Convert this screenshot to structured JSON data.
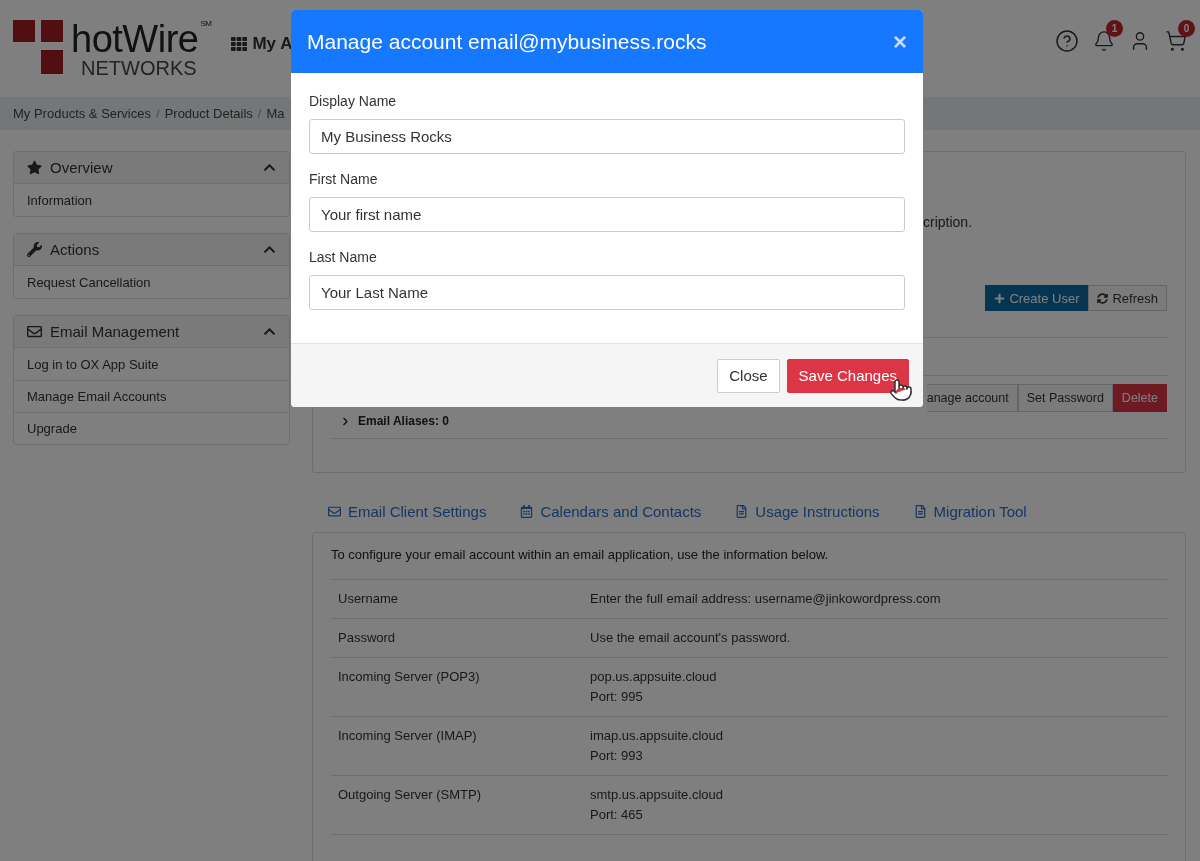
{
  "header": {
    "logo": {
      "name": "hotWire",
      "mark": "SM",
      "sub": "NETWORKS"
    },
    "nav_label": "My A",
    "notification_count": "1",
    "cart_count": "0"
  },
  "breadcrumb": [
    {
      "kind": "link",
      "text": "My Products & Services"
    },
    {
      "kind": "separator",
      "text": "/"
    },
    {
      "kind": "link",
      "text": "Product Details"
    },
    {
      "kind": "separator",
      "text": "/"
    },
    {
      "kind": "link",
      "text": "Ma"
    }
  ],
  "sidebar": [
    {
      "title": "Overview",
      "expanded": true,
      "items": [
        "Information"
      ]
    },
    {
      "title": "Actions",
      "expanded": true,
      "items": [
        "Request Cancellation"
      ]
    },
    {
      "title": "Email Management",
      "expanded": true,
      "items": [
        "Log in to OX App Suite",
        "Manage Email Accounts",
        "Upgrade"
      ]
    }
  ],
  "main": {
    "description_tail": "cription.",
    "toolbar": [
      {
        "label": "Create User",
        "kind": "primary"
      },
      {
        "label": "Refresh",
        "kind": "default"
      }
    ],
    "account_actions": [
      {
        "label": "anage account",
        "kind": "default"
      },
      {
        "label": "Set Password",
        "kind": "default"
      },
      {
        "label": "Delete",
        "kind": "danger"
      }
    ],
    "aliases": "Email Aliases: 0"
  },
  "tabs": [
    {
      "label": "Email Client Settings"
    },
    {
      "label": "Calendars and Contacts"
    },
    {
      "label": "Usage Instructions"
    },
    {
      "label": "Migration Tool"
    }
  ],
  "settings": {
    "intro": "To configure your email account within an email application, use the information below.",
    "rows": [
      {
        "label": "Username",
        "value": [
          "Enter the full email address: username@jinkowordpress.com"
        ]
      },
      {
        "label": "Password",
        "value": [
          "Use the email account's password."
        ]
      },
      {
        "label": "Incoming Server (POP3)",
        "value": [
          "pop.us.appsuite.cloud",
          "Port: 995"
        ]
      },
      {
        "label": "Incoming Server (IMAP)",
        "value": [
          "imap.us.appsuite.cloud",
          "Port: 993"
        ]
      },
      {
        "label": "Outgoing Server (SMTP)",
        "value": [
          "smtp.us.appsuite.cloud",
          "Port: 465"
        ]
      }
    ]
  },
  "modal": {
    "title": "Manage account email@mybusiness.rocks",
    "close": "×",
    "fields": [
      {
        "label": "Display Name",
        "value": "My Business Rocks"
      },
      {
        "label": "First Name",
        "value": "Your first name"
      },
      {
        "label": "Last Name",
        "value": "Your Last Name"
      }
    ],
    "buttons": [
      {
        "label": "Close",
        "kind": "default"
      },
      {
        "label": "Save Changes",
        "kind": "danger"
      }
    ]
  }
}
